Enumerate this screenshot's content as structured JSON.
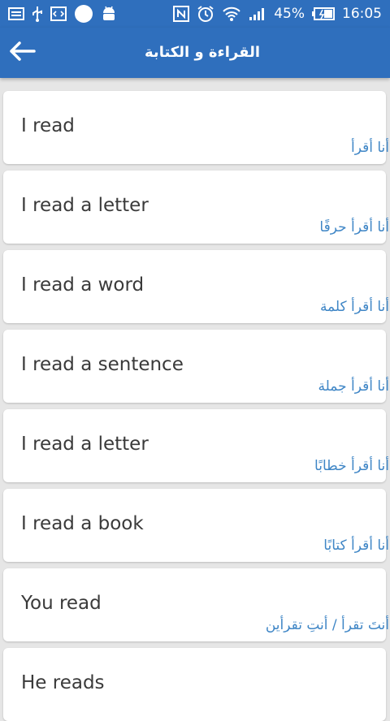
{
  "status_bar": {
    "battery_percent": "45%",
    "time": "16:05",
    "icons_left": [
      "image-icon",
      "usb-icon",
      "code-icon",
      "circle-icon",
      "android-icon"
    ],
    "icons_right": [
      "nfc-icon",
      "alarm-icon",
      "wifi-icon",
      "signal-icon",
      "battery-icon"
    ]
  },
  "app_bar": {
    "title": "القراءة و الكتابة",
    "back_icon": "arrow-left-icon"
  },
  "phrases": [
    {
      "en": "I read",
      "ar": "أنا أقرأ"
    },
    {
      "en": "I read a letter",
      "ar": "أنا أقرأ حرفًا"
    },
    {
      "en": "I read a word",
      "ar": "أنا أقرأ كلمة"
    },
    {
      "en": "I read a sentence",
      "ar": "أنا أقرأ جملة"
    },
    {
      "en": "I read a letter",
      "ar": "أنا أقرأ خطابًا"
    },
    {
      "en": "I read a book",
      "ar": "أنا أقرأ كتابًا"
    },
    {
      "en": "You read",
      "ar": "أنتَ تقرأ / أنتِ تقرأين"
    },
    {
      "en": "He reads",
      "ar": ""
    }
  ],
  "colors": {
    "primary": "#2f6fbd",
    "arabic_text": "#3f86c6",
    "english_text": "#3a3a3a",
    "background": "#e6e6e6"
  }
}
